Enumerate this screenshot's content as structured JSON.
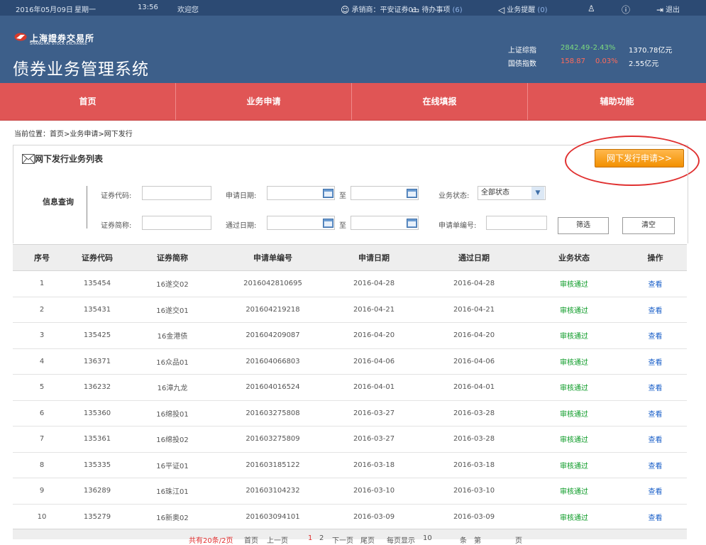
{
  "topbar": {
    "date": "2016年05月09日",
    "weekday": "星期一",
    "time": "13:56",
    "welcome": "欢迎您",
    "underwriter": "承销商：平安证券01",
    "todo_label": "待办事项",
    "todo_count": "(6)",
    "reminder_label": "业务提醒",
    "reminder_count": "(0)",
    "logout": "退出"
  },
  "header": {
    "logo_cn": "上海證券交易所",
    "logo_en": "SHANGHAI STOCK EXCHANGE",
    "system_title": "债券业务管理系统",
    "indices": [
      {
        "name": "上证综指",
        "value": "2842.49",
        "change": "-2.43%",
        "amount": "1370.78亿元"
      },
      {
        "name": "国债指数",
        "value": "158.87",
        "change": "0.03%",
        "amount": "2.55亿元"
      }
    ]
  },
  "nav": [
    "首页",
    "业务申请",
    "在线填报",
    "辅助功能"
  ],
  "breadcrumb": "当前位置：首页>业务申请>网下发行",
  "panel": {
    "title": "网下发行业务列表",
    "apply_button": "网下发行申请>>"
  },
  "query": {
    "title": "信息查询",
    "code_label": "证券代码:",
    "apply_date_label": "申请日期:",
    "to1": "至",
    "status_label": "业务状态:",
    "status_value": "全部状态",
    "short_label": "证券简称:",
    "pass_date_label": "通过日期:",
    "to2": "至",
    "appno_label": "申请单编号:",
    "filter_button": "筛选",
    "clear_button": "清空"
  },
  "table": {
    "headers": [
      "序号",
      "证券代码",
      "证券简称",
      "申请单编号",
      "申请日期",
      "通过日期",
      "业务状态",
      "操作"
    ],
    "rows": [
      [
        "1",
        "135454",
        "16遂交02",
        "2016042810695",
        "2016-04-28",
        "2016-04-28",
        "审核通过",
        "查看"
      ],
      [
        "2",
        "135431",
        "16遂交01",
        "201604219218",
        "2016-04-21",
        "2016-04-21",
        "审核通过",
        "查看"
      ],
      [
        "3",
        "135425",
        "16金港债",
        "201604209087",
        "2016-04-20",
        "2016-04-20",
        "审核通过",
        "查看"
      ],
      [
        "4",
        "136371",
        "16众品01",
        "201604066803",
        "2016-04-06",
        "2016-04-06",
        "审核通过",
        "查看"
      ],
      [
        "5",
        "136232",
        "16漳九龙",
        "201604016524",
        "2016-04-01",
        "2016-04-01",
        "审核通过",
        "查看"
      ],
      [
        "6",
        "135360",
        "16绵投01",
        "201603275808",
        "2016-03-27",
        "2016-03-28",
        "审核通过",
        "查看"
      ],
      [
        "7",
        "135361",
        "16绵投02",
        "201603275809",
        "2016-03-27",
        "2016-03-28",
        "审核通过",
        "查看"
      ],
      [
        "8",
        "135335",
        "16平证01",
        "201603185122",
        "2016-03-18",
        "2016-03-18",
        "审核通过",
        "查看"
      ],
      [
        "9",
        "136289",
        "16珠江01",
        "201603104232",
        "2016-03-10",
        "2016-03-10",
        "审核通过",
        "查看"
      ],
      [
        "10",
        "135279",
        "16新奥02",
        "201603094101",
        "2016-03-09",
        "2016-03-09",
        "审核通过",
        "查看"
      ]
    ]
  },
  "pager": {
    "total": "共有20条/2页",
    "first": "首页",
    "prev": "上一页",
    "page1": "1",
    "page2": "2",
    "next": "下一页",
    "last": "尾页",
    "per_page_label": "每页显示",
    "per_page_value": "10",
    "per_page_unit": "条",
    "goto_label": "第",
    "goto_unit": "页"
  },
  "colors": {
    "topbar": "#2c4a73",
    "header": "#3d5f8a",
    "nav": "#e05555",
    "status_ok": "#0a9a25",
    "link": "#1a5fc8",
    "apply_button": "#f29000"
  }
}
